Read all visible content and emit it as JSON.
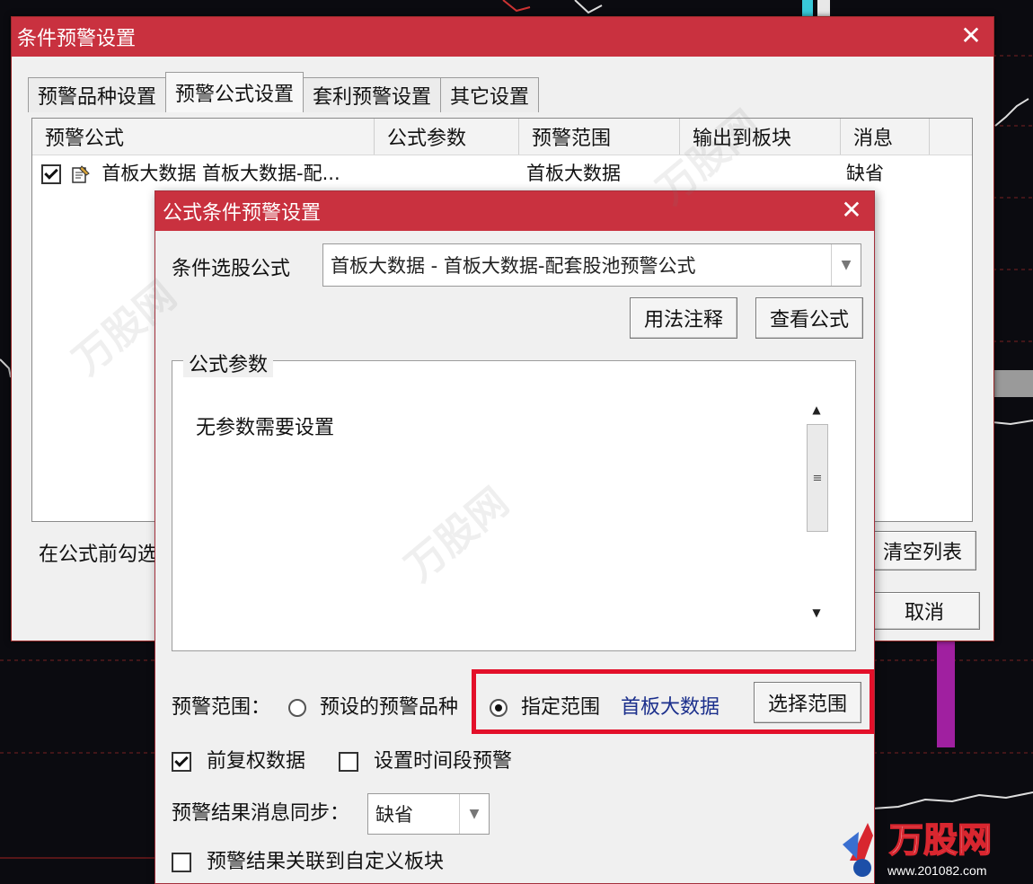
{
  "main_window": {
    "title": "条件预警设置",
    "close_glyph": "✕",
    "tabs": [
      {
        "label": "预警品种设置"
      },
      {
        "label": "预警公式设置"
      },
      {
        "label": "套利预警设置"
      },
      {
        "label": "其它设置"
      }
    ],
    "active_tab": "预警公式设置",
    "table": {
      "headers": [
        "预警公式",
        "公式参数",
        "预警范围",
        "输出到板块",
        "消息"
      ],
      "rows": [
        {
          "checked": true,
          "formula": "首板大数据 首板大数据-配...",
          "params": "",
          "range": "首板大数据",
          "output": "",
          "message": "缺省"
        }
      ]
    },
    "bottom_hint": "在公式前勾选",
    "clear_list_label": "清空列表",
    "cancel_label": "取消"
  },
  "dialog": {
    "title": "公式条件预警设置",
    "close_glyph": "✕",
    "formula_label": "条件选股公式",
    "formula_value": "首板大数据  -  首板大数据-配套股池预警公式",
    "usage_button": "用法注释",
    "view_formula_button": "查看公式",
    "params_group_label": "公式参数",
    "params_text": "无参数需要设置",
    "range_label": "预警范围：",
    "radio_preset_label": "预设的预警品种",
    "radio_specified_label": "指定范围",
    "specified_value": "首板大数据",
    "select_range_button": "选择范围",
    "adjust_label": "前复权数据",
    "adjust_checked": true,
    "time_period_label": "设置时间段预警",
    "time_period_checked": false,
    "sync_label": "预警结果消息同步：",
    "sync_value": "缺省",
    "link_label": "预警结果关联到自定义板块",
    "link_checked": false
  },
  "colors": {
    "titlebar": "#c9313f",
    "highlight": "#e3102a",
    "link_blue": "#1b2f8c"
  },
  "icons": {
    "close": "close-icon",
    "dropdown": "chevron-down-icon",
    "scroll_up": "arrow-up-icon",
    "scroll_down": "arrow-down-icon",
    "formula_row": "formula-doc-icon"
  },
  "watermark": {
    "text": "万股网",
    "url": "www.201082.com"
  }
}
